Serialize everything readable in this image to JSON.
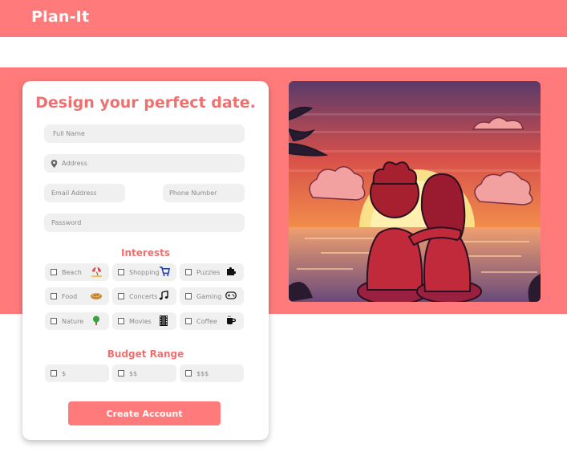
{
  "header": {
    "brand": "Plan-It"
  },
  "form": {
    "title": "Design your perfect date.",
    "full_name_placeholder": "Full Name",
    "address_placeholder": "Address",
    "email_placeholder": "Email Address",
    "phone_placeholder": "Phone Number",
    "password_placeholder": "Password",
    "interests_title": "Interests",
    "interests": [
      {
        "label": "Beach",
        "icon": "beach-umbrella-icon"
      },
      {
        "label": "Shopping",
        "icon": "shopping-cart-icon"
      },
      {
        "label": "Puzzles",
        "icon": "puzzle-piece-icon"
      },
      {
        "label": "Food",
        "icon": "pie-icon"
      },
      {
        "label": "Concerts",
        "icon": "music-note-icon"
      },
      {
        "label": "Gaming",
        "icon": "gamepad-icon"
      },
      {
        "label": "Nature",
        "icon": "tree-icon"
      },
      {
        "label": "Movies",
        "icon": "film-strip-icon"
      },
      {
        "label": "Coffee",
        "icon": "coffee-cup-icon"
      }
    ],
    "budget_title": "Budget Range",
    "budgets": [
      "$",
      "$$",
      "$$$"
    ],
    "submit_label": "Create Account"
  },
  "colors": {
    "brand": "#ff7b7b",
    "accent_text": "#f07070",
    "field_bg": "#f0f0f0"
  }
}
